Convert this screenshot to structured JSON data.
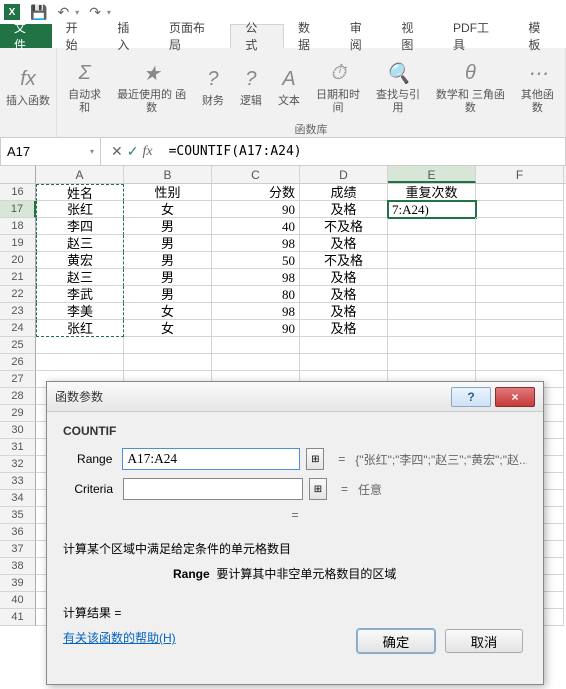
{
  "titlebar": {
    "app": "X"
  },
  "tabs": {
    "file": "文件",
    "home": "开始",
    "insert": "插入",
    "layout": "页面布局",
    "formula": "公式",
    "data": "数据",
    "review": "审阅",
    "view": "视图",
    "pdf": "PDF工具",
    "template": "模板"
  },
  "ribbon": {
    "insertfn": "插入函数",
    "autosum": "自动求和",
    "recent": "最近使用的\n函数",
    "financial": "财务",
    "logical": "逻辑",
    "text": "文本",
    "datetime": "日期和时间",
    "lookup": "查找与引用",
    "math": "数学和\n三角函数",
    "other": "其他函数",
    "grouplabel": "函数库",
    "fx_icon": "fx",
    "sigma": "Σ"
  },
  "formulabar": {
    "namebox": "A17",
    "cancel": "✕",
    "confirm": "✓",
    "fx": "fx",
    "formula": "=COUNTIF(A17:A24)"
  },
  "columns": [
    "A",
    "B",
    "C",
    "D",
    "E",
    "F"
  ],
  "rows": [
    {
      "n": 16,
      "a": "姓名",
      "b": "性别",
      "c": "分数",
      "d": "成绩",
      "e": "重复次数"
    },
    {
      "n": 17,
      "a": "张红",
      "b": "女",
      "c": "90",
      "d": "及格",
      "e": "7:A24)"
    },
    {
      "n": 18,
      "a": "李四",
      "b": "男",
      "c": "40",
      "d": "不及格",
      "e": ""
    },
    {
      "n": 19,
      "a": "赵三",
      "b": "男",
      "c": "98",
      "d": "及格",
      "e": ""
    },
    {
      "n": 20,
      "a": "黄宏",
      "b": "男",
      "c": "50",
      "d": "不及格",
      "e": ""
    },
    {
      "n": 21,
      "a": "赵三",
      "b": "男",
      "c": "98",
      "d": "及格",
      "e": ""
    },
    {
      "n": 22,
      "a": "李武",
      "b": "男",
      "c": "80",
      "d": "及格",
      "e": ""
    },
    {
      "n": 23,
      "a": "李美",
      "b": "女",
      "c": "98",
      "d": "及格",
      "e": ""
    },
    {
      "n": 24,
      "a": "张红",
      "b": "女",
      "c": "90",
      "d": "及格",
      "e": ""
    }
  ],
  "empty_rows": [
    25,
    26,
    27,
    28,
    29,
    30,
    31,
    32,
    33,
    34,
    35,
    36,
    37,
    38,
    39,
    40,
    41
  ],
  "dialog": {
    "title": "函数参数",
    "fname": "COUNTIF",
    "range_label": "Range",
    "range_value": "A17:A24",
    "range_preview": "{\"张红\";\"李四\";\"赵三\";\"黄宏\";\"赵...",
    "criteria_label": "Criteria",
    "criteria_value": "",
    "criteria_preview": "任意",
    "eq_sep": "=",
    "desc": "计算某个区域中满足给定条件的单元格数目",
    "hint_label": "Range",
    "hint_text": "要计算其中非空单元格数目的区域",
    "result_label": "计算结果 =",
    "link": "有关该函数的帮助(H)",
    "ok": "确定",
    "cancel": "取消",
    "help_icon": "?",
    "close_icon": "×"
  }
}
